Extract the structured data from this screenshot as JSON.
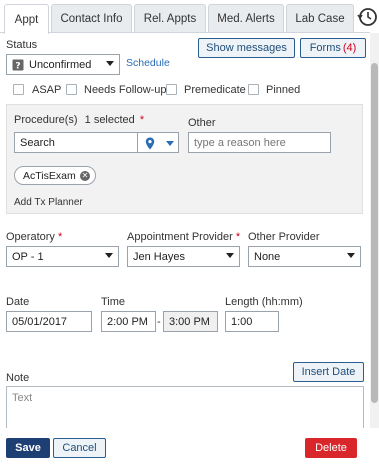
{
  "tabs": [
    {
      "label": "Appt"
    },
    {
      "label": "Contact Info"
    },
    {
      "label": "Rel. Appts"
    },
    {
      "label": "Med. Alerts"
    },
    {
      "label": "Lab Case"
    }
  ],
  "status": {
    "label": "Status",
    "value": "Unconfirmed",
    "schedule_link": "Schedule"
  },
  "buttons": {
    "show_messages": "Show messages",
    "forms_label": "Forms",
    "forms_count": "(4)",
    "insert_date": "Insert Date",
    "save": "Save",
    "cancel": "Cancel",
    "delete": "Delete"
  },
  "checkboxes": [
    {
      "label": "ASAP",
      "checked": false
    },
    {
      "label": "Needs Follow-up",
      "checked": false
    },
    {
      "label": "Premedicate",
      "checked": false
    },
    {
      "label": "Pinned",
      "checked": false
    }
  ],
  "procedures": {
    "label": "Procedure(s)",
    "selected_text": "1 selected",
    "required": "*",
    "search_value": "Search",
    "other_label": "Other",
    "other_placeholder": "type a reason here",
    "chip": "AcTisExam",
    "add_tx_planner": "Add Tx Planner"
  },
  "operatory": {
    "label": "Operatory",
    "required": "*",
    "value": "OP - 1"
  },
  "appointment_provider": {
    "label": "Appointment Provider",
    "required": "*",
    "value": "Jen Hayes"
  },
  "other_provider": {
    "label": "Other Provider",
    "value": "None"
  },
  "date": {
    "label": "Date",
    "value": "05/01/2017"
  },
  "time": {
    "label": "Time",
    "start": "2:00 PM",
    "separator": "-",
    "end": "3:00 PM"
  },
  "length": {
    "label": "Length (hh:mm)",
    "value": "1:00"
  },
  "note": {
    "label": "Note",
    "placeholder": "Text"
  },
  "colors": {
    "accent": "#1e3f73",
    "delete": "#d9262b",
    "required": "#d0021b",
    "link": "#2a6db5"
  }
}
